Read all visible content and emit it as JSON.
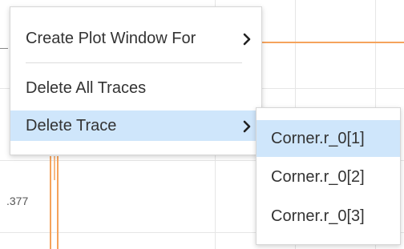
{
  "plot": {
    "tick_label": ".377",
    "trace_color": "#f5a35c",
    "grid_color": "#e6e6e6"
  },
  "context_menu": {
    "items": [
      {
        "label": "Create Plot Window For",
        "has_submenu": true,
        "selected": false
      },
      {
        "label": "Delete All Traces",
        "has_submenu": false,
        "selected": false
      },
      {
        "label": "Delete Trace",
        "has_submenu": true,
        "selected": true
      }
    ],
    "highlight_color": "#cfe6fb",
    "chevron_icon": "chevron-right-icon"
  },
  "submenu": {
    "items": [
      {
        "label": "Corner.r_0[1]",
        "selected": true
      },
      {
        "label": "Corner.r_0[2]",
        "selected": false
      },
      {
        "label": "Corner.r_0[3]",
        "selected": false
      }
    ]
  }
}
